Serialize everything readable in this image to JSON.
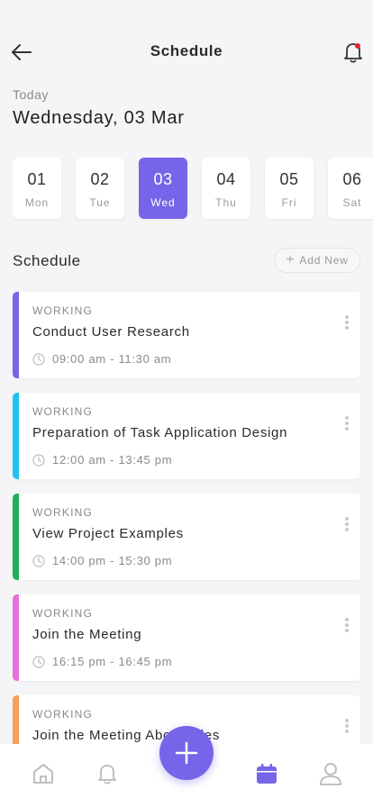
{
  "header": {
    "title": "Schedule"
  },
  "date": {
    "label": "Today",
    "value": "Wednesday, 03 Mar"
  },
  "days": [
    {
      "num": "01",
      "name": "Mon",
      "active": false
    },
    {
      "num": "02",
      "name": "Tue",
      "active": false
    },
    {
      "num": "03",
      "name": "Wed",
      "active": true
    },
    {
      "num": "04",
      "name": "Thu",
      "active": false
    },
    {
      "num": "05",
      "name": "Fri",
      "active": false
    },
    {
      "num": "06",
      "name": "Sat",
      "active": false
    }
  ],
  "schedule": {
    "title": "Schedule",
    "add_label": "Add New",
    "items": [
      {
        "category": "WORKING",
        "title": "Conduct User Research",
        "time": "09:00 am - 11:30 am",
        "color": "#7565e8"
      },
      {
        "category": "WORKING",
        "title": "Preparation of Task Application Design",
        "time": "12:00 am - 13:45 pm",
        "color": "#1ec3f0"
      },
      {
        "category": "WORKING",
        "title": "View Project Examples",
        "time": "14:00 pm - 15:30 pm",
        "color": "#1fae5a"
      },
      {
        "category": "WORKING",
        "title": "Join the Meeting",
        "time": "16:15 pm - 16:45 pm",
        "color": "#e471d8"
      },
      {
        "category": "WORKING",
        "title": "Join the Meeting About Files",
        "time": "",
        "color": "#f5a05e"
      }
    ]
  },
  "nav": {
    "items": [
      "home-icon",
      "bell-icon",
      "calendar-icon",
      "user-icon"
    ],
    "active": "calendar-icon",
    "active_color": "#7565e8",
    "inactive_color": "#b8b8bd"
  },
  "accent": "#7565e8"
}
